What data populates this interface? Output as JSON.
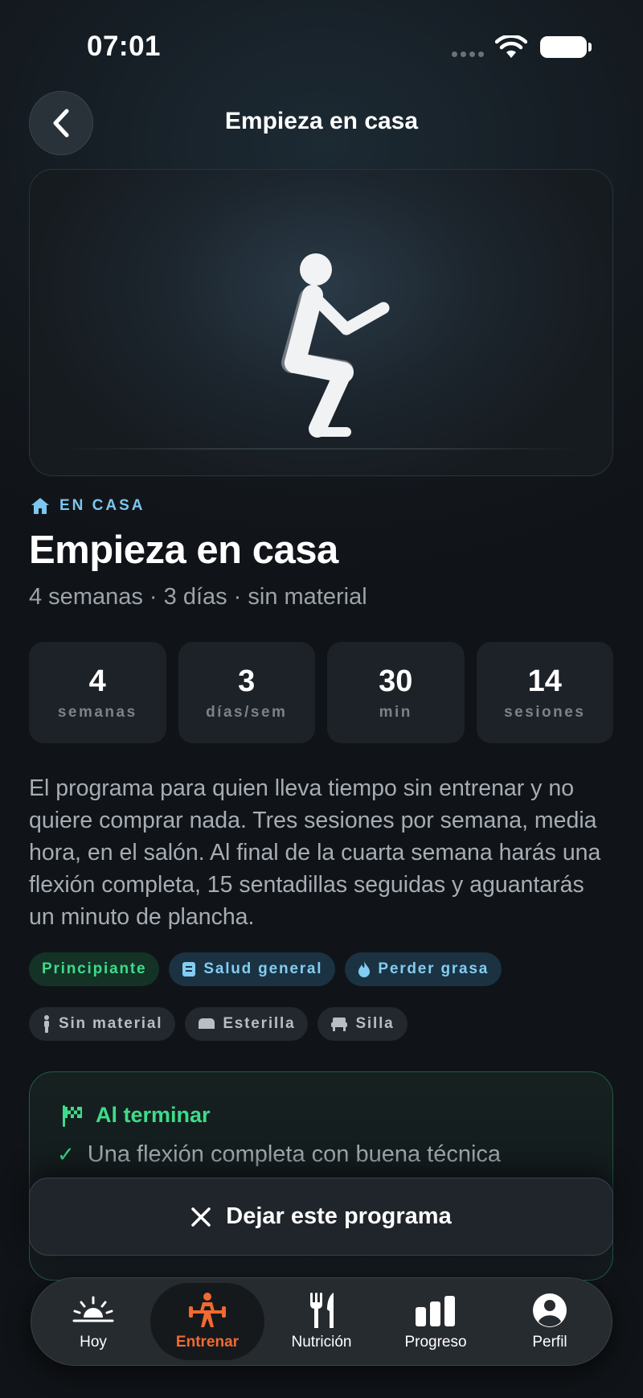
{
  "status": {
    "time": "07:01"
  },
  "header": {
    "title": "Empieza en casa"
  },
  "program": {
    "category": "EN CASA",
    "title": "Empieza en casa",
    "subtitle": "4 semanas · 3 días · sin material",
    "stats": [
      {
        "value": "4",
        "unit": "semanas"
      },
      {
        "value": "3",
        "unit": "días/sem"
      },
      {
        "value": "30",
        "unit": "min"
      },
      {
        "value": "14",
        "unit": "sesiones"
      }
    ],
    "description": "El programa para quien lleva tiempo sin entrenar y no quiere comprar nada. Tres sesiones por semana, media hora, en el salón. Al final de la cuarta semana harás una flexión completa, 15 sentadillas seguidas y aguantarás un minuto de plancha.",
    "goal_chips": [
      "Principiante",
      "Salud general",
      "Perder grasa"
    ],
    "equipment_chips": [
      "Sin material",
      "Esterilla",
      "Silla"
    ]
  },
  "outcomes": {
    "heading": "Al terminar",
    "items": [
      "Una flexión completa con buena técnica"
    ]
  },
  "leave_button": {
    "label": "Dejar este programa"
  },
  "tabs": [
    {
      "label": "Hoy",
      "icon": "sunrise-icon"
    },
    {
      "label": "Entrenar",
      "icon": "weightlifter-icon",
      "active": true
    },
    {
      "label": "Nutrición",
      "icon": "fork-knife-icon"
    },
    {
      "label": "Progreso",
      "icon": "bar-chart-icon"
    },
    {
      "label": "Perfil",
      "icon": "person-circle-icon"
    }
  ],
  "colors": {
    "accent_green": "#3ddc8a",
    "accent_blue": "#7cc6ef",
    "active_tab": "#f06a32",
    "background": "#111418"
  }
}
